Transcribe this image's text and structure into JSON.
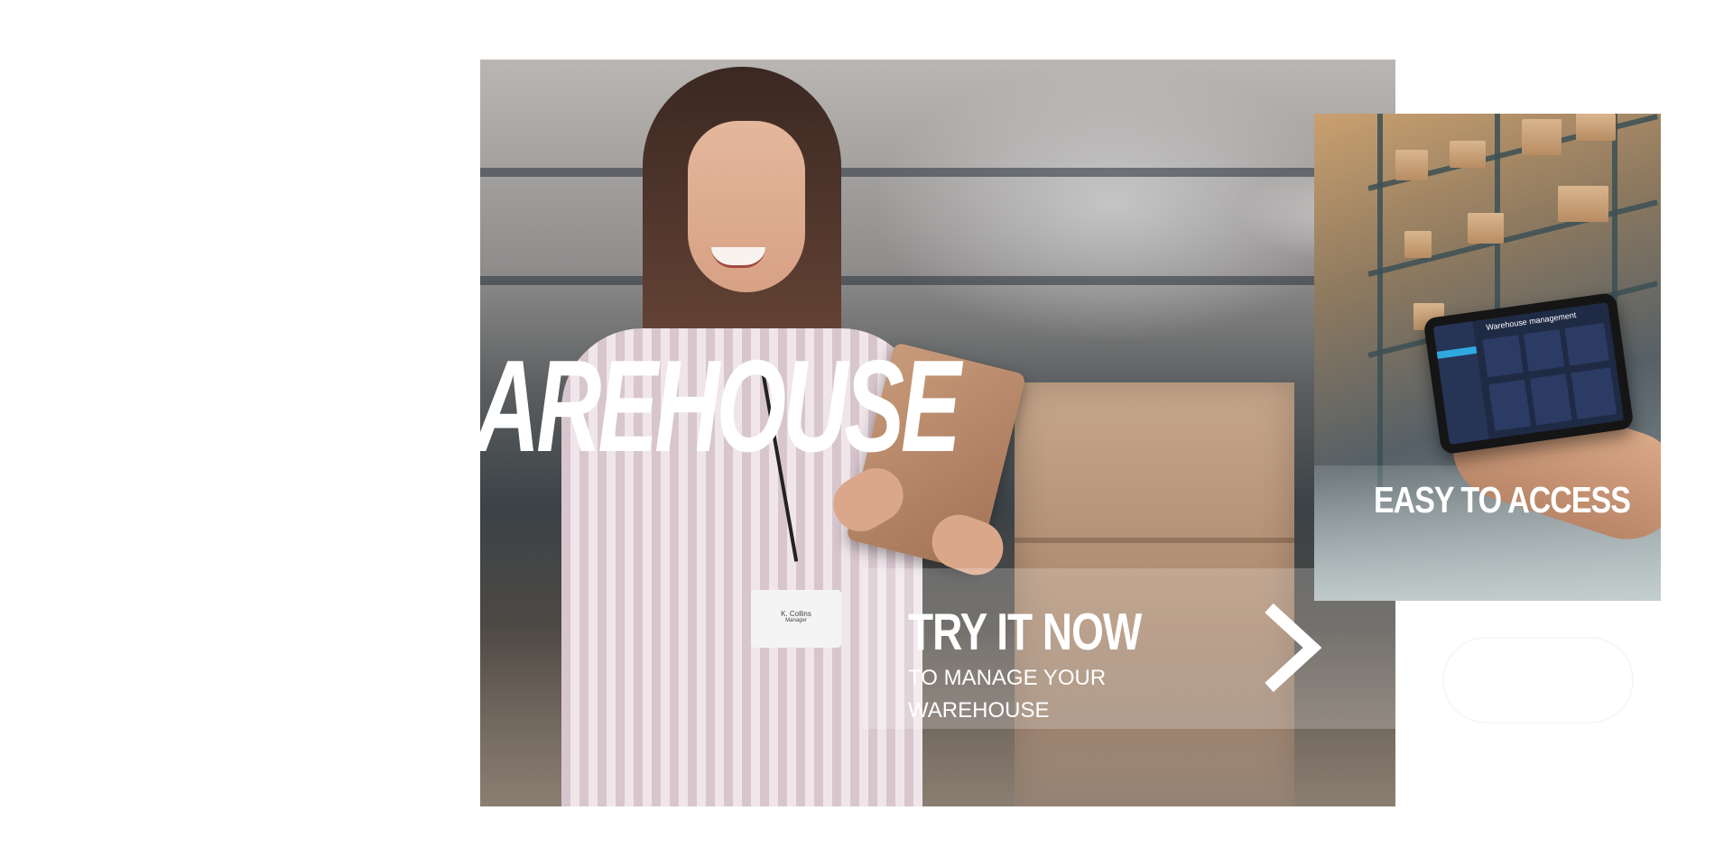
{
  "headline": {
    "line_top": "",
    "line_bottom": "AREHOUSE"
  },
  "cta": {
    "title": "TRY IT NOW",
    "subtitle": "TO MANAGE YOUR WAREHOUSE",
    "arrow_icon": "chevron-right-icon"
  },
  "side_card": {
    "caption": "EASY TO ACCESS",
    "tablet_screen_title": "Warehouse management"
  },
  "badge": {
    "name": "K. Collins",
    "role": "Manager"
  },
  "colors": {
    "text": "#ffffff",
    "cta_overlay": "rgba(255,255,255,0.22)"
  }
}
